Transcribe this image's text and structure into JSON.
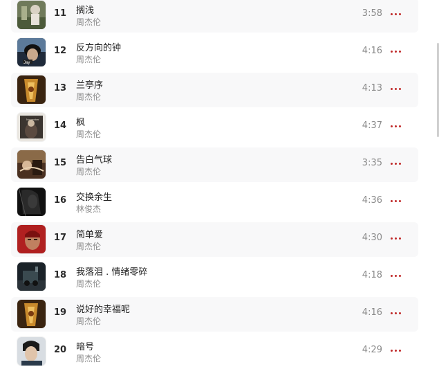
{
  "tracks": [
    {
      "number": "11",
      "title": "搁浅",
      "artist": "周杰伦",
      "duration": "3:58",
      "cover_icon": "album-cover-qiliXiang"
    },
    {
      "number": "12",
      "title": "反方向的钟",
      "artist": "周杰伦",
      "duration": "4:16",
      "cover_icon": "album-cover-jay"
    },
    {
      "number": "13",
      "title": "兰亭序",
      "artist": "周杰伦",
      "duration": "4:13",
      "cover_icon": "album-cover-mojie"
    },
    {
      "number": "14",
      "title": "枫",
      "artist": "周杰伦",
      "duration": "4:37",
      "cover_icon": "album-cover-november-chopin"
    },
    {
      "number": "15",
      "title": "告白气球",
      "artist": "周杰伦",
      "duration": "3:35",
      "cover_icon": "album-cover-bed-time-stories"
    },
    {
      "number": "16",
      "title": "交换余生",
      "artist": "林俊杰",
      "duration": "4:36",
      "cover_icon": "album-cover-dark"
    },
    {
      "number": "17",
      "title": "简单爱",
      "artist": "周杰伦",
      "duration": "4:30",
      "cover_icon": "album-cover-fantasy"
    },
    {
      "number": "18",
      "title": "我落泪 . 情绪零碎",
      "artist": "周杰伦",
      "duration": "4:18",
      "cover_icon": "album-cover-train"
    },
    {
      "number": "19",
      "title": "说好的幸福呢",
      "artist": "周杰伦",
      "duration": "4:16",
      "cover_icon": "album-cover-mojie"
    },
    {
      "number": "20",
      "title": "暗号",
      "artist": "周杰伦",
      "duration": "4:29",
      "cover_icon": "album-cover-portrait"
    }
  ],
  "colors": {
    "accent": "#c02a2a",
    "row_alt_bg": "#f8f8f9",
    "title_text": "#222222",
    "secondary_text": "#8a8a8a"
  },
  "more_icon": "more-dots-icon"
}
